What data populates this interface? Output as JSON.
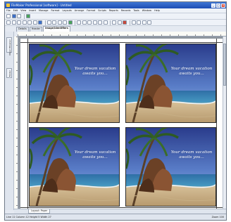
{
  "window": {
    "title": "FileMaker Professional [software] - Untitled"
  },
  "menus": [
    "File",
    "Edit",
    "View",
    "Insert",
    "Manage",
    "Format",
    "Layouts",
    "Arrange",
    "Format",
    "Scripts",
    "Reports",
    "Records",
    "Tools",
    "Window",
    "Help"
  ],
  "tabs": [
    "Details",
    "Header",
    "Image/Identifiers"
  ],
  "side_tabs": [
    "Object Browser",
    "Folder"
  ],
  "photo_caption": [
    "Your dream vacation",
    "awaits you..."
  ],
  "layout_tab": "Layout: Paper",
  "status": {
    "left": "Line 11  Column 12  Height 5  Width 27",
    "zoom": "Zoom 100"
  },
  "colors": {
    "accent": "#1c4db3",
    "workspace": "#8f969f"
  }
}
